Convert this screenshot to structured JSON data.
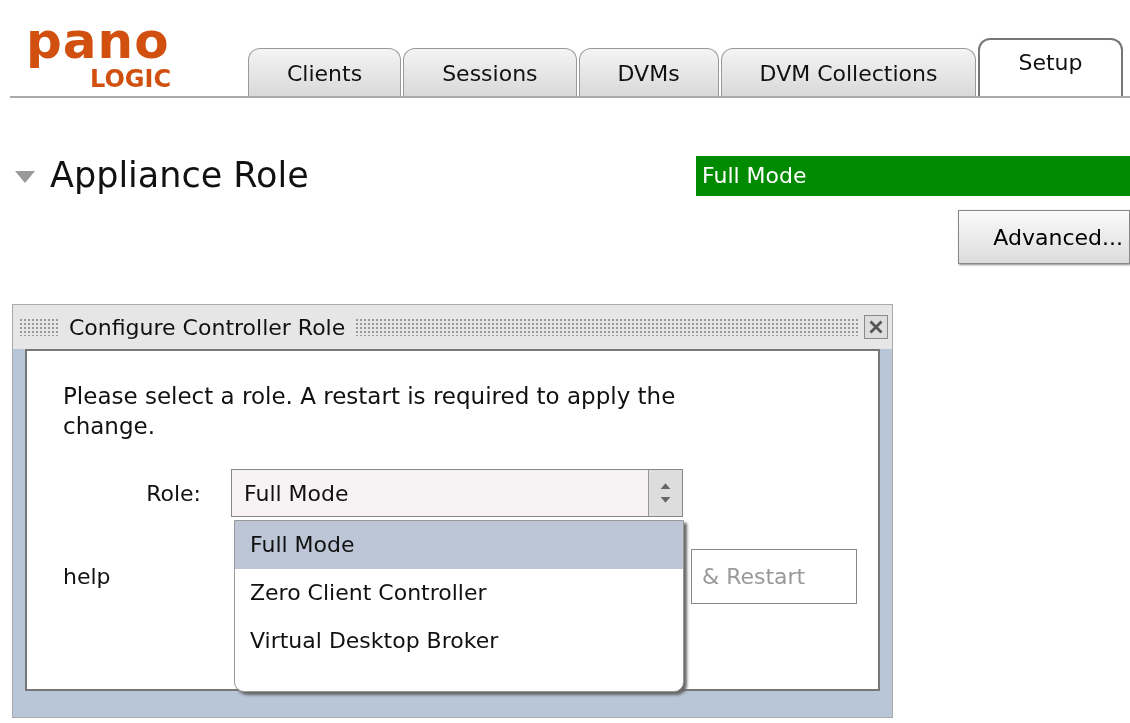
{
  "logo": {
    "top": "pano",
    "bottom": "LOGIC"
  },
  "tabs": [
    {
      "label": "Clients",
      "selected": false
    },
    {
      "label": "Sessions",
      "selected": false
    },
    {
      "label": "DVMs",
      "selected": false
    },
    {
      "label": "DVM Collections",
      "selected": false
    },
    {
      "label": "Setup",
      "selected": true
    }
  ],
  "section": {
    "title": "Appliance Role",
    "expanded": true,
    "status": "Full Mode",
    "advanced_button": "Advanced..."
  },
  "dialog": {
    "title": "Configure Controller Role",
    "message": "Please select a role. A restart is required to apply the change.",
    "role_label": "Role:",
    "role_value": "Full Mode",
    "help": "help",
    "restart_button": "& Restart",
    "options": [
      {
        "label": "Full Mode",
        "selected": true
      },
      {
        "label": "Zero Client Controller",
        "selected": false
      },
      {
        "label": "Virtual Desktop Broker",
        "selected": false
      }
    ]
  }
}
